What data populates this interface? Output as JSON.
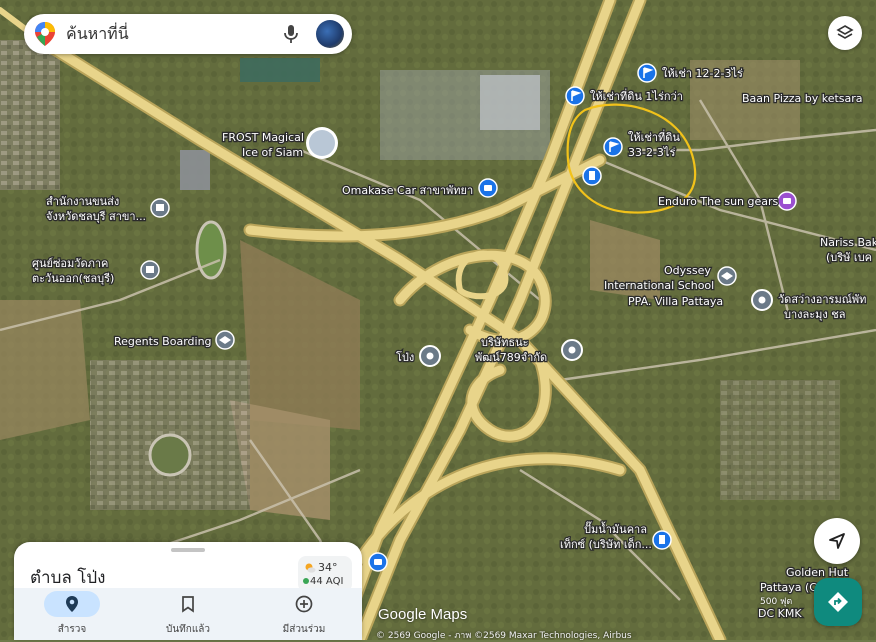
{
  "search": {
    "placeholder": "ค้นหาที่นี่"
  },
  "labels": {
    "frost_1": "FROST Magical",
    "frost_2": "Ice of Siam",
    "omakase": "Omakase Car สาขาพัทยา",
    "office_1": "สำนักงานขนส่ง",
    "office_2": "จังหวัดชลบุรี สาขา...",
    "center_1": "ศูนย์ซ่อมวัดภาค",
    "center_2": "ตะวันออก(ชลบุรี)",
    "regents": "Regents Boarding",
    "pong": "โป่ง",
    "company_1": "บริษัทธนะ",
    "company_2": "พัฒน์789จำกัด",
    "rent_land_1": "ให้เช่าที่ดิน 1ไร่กว่า",
    "rent_12": "ให้เช่า 12-2-3ไร่",
    "rent_33_1": "ให้เช่าที่ดิน",
    "rent_33_2": "33-2-3ไร่",
    "pizza": "Baan Pizza by ketsara",
    "enduro": "Enduro The sun gears",
    "nariss_1": "Nariss Bak",
    "nariss_2": "(บริษั เบค",
    "odyssey_1": "Odyssey",
    "odyssey_2": "International School",
    "ppa": "PPA. Villa Pattaya",
    "temple_1": "วัดสว่างอารมณ์พัท",
    "temple_2": "บางละมุง ชล",
    "gas_1": "ปั๊มน้ำมันคาล",
    "gas_2": "เท็กซ์ (บริษัท เด็ก...",
    "golden_1": "Golden Hut",
    "golden_2": "Pattaya (C",
    "dc": "DC KMK"
  },
  "sheet": {
    "place": "ตำบล โป่ง",
    "temp": "34°",
    "aqi": "44 AQI",
    "nav": [
      "สำรวจ",
      "บันทึกแล้ว",
      "มีส่วนร่วม"
    ]
  },
  "footer": {
    "logo": "Google Maps",
    "attribution": "© 2569 Google - ภาพ ©2569 Maxar Technologies, Airbus",
    "scale": "500 ฟุต"
  },
  "colors": {
    "road": "#e8d48a",
    "road_edge": "#b9a45a",
    "highlight": "#f2c21a",
    "pin_blue": "#1a73e8",
    "pin_purple": "#9b4fd0",
    "directions": "#0f8a7e"
  }
}
